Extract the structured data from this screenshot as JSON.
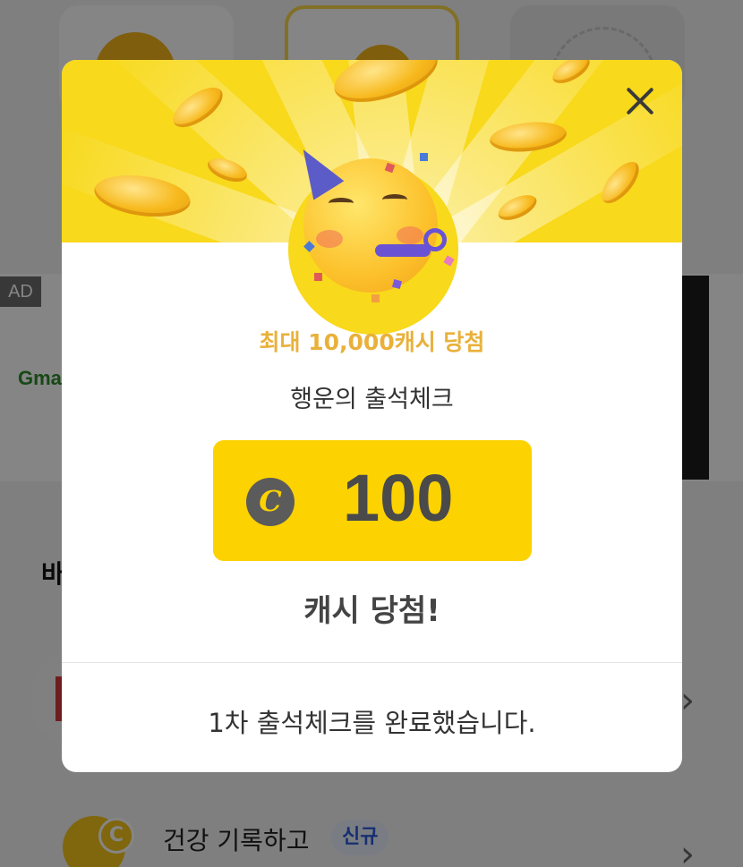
{
  "background": {
    "ad_label": "AD",
    "ad_brand": "Gma",
    "section_letter_partial": "바",
    "health_item": {
      "label": "건강 기록하고",
      "badge": "신규",
      "coin_glyph": "C"
    },
    "chevron_glyph": "›"
  },
  "modal": {
    "close_glyph": "",
    "promo_text": "최대 10,000캐시 당첨",
    "subtitle": "행운의 출석체크",
    "amount": {
      "currency_glyph": "C",
      "value": "100"
    },
    "result_text": "캐시 당첨!",
    "footer_message": "1차 출석체크를 완료했습니다."
  },
  "colors": {
    "accent_yellow": "#fcd200",
    "promo_gold": "#e9b13a",
    "badge_blue": "#2a5bd7"
  },
  "icons": [
    "close-icon",
    "party-face-emoji-icon",
    "cash-coin-icon",
    "chevron-right-icon"
  ]
}
